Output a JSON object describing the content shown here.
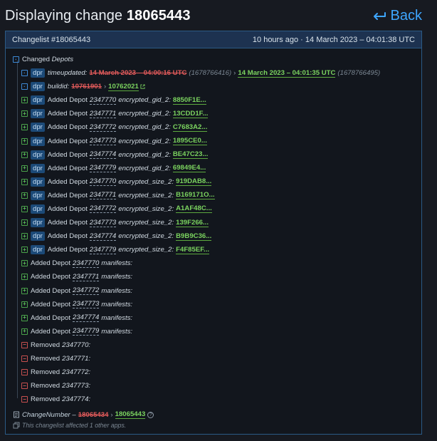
{
  "header": {
    "title_prefix": "Displaying change",
    "change_number": "18065443",
    "back_label": "Back"
  },
  "panel": {
    "title": "Changelist #18065443",
    "time": "10 hours ago · 14 March 2023 – 04:01:38 UTC"
  },
  "tree": {
    "root_label": "Changed",
    "root_label_it": "Depots",
    "timeupdated": {
      "badge": "dpr",
      "key": "timeupdated:",
      "old": "14 March 2023 – 04:00:16 UTC",
      "old_raw": "(1678766416)",
      "new": "14 March 2023 – 04:01:35 UTC",
      "new_raw": "(1678766495)"
    },
    "buildid": {
      "badge": "dpr",
      "key": "buildid:",
      "old": "10761901",
      "new": "10762021"
    },
    "added_keys": [
      {
        "badge": "dpr",
        "depot": "2347770",
        "key": "encrypted_gid_2:",
        "value": "8850F1E..."
      },
      {
        "badge": "dpr",
        "depot": "2347771",
        "key": "encrypted_gid_2:",
        "value": "13CDD1F..."
      },
      {
        "badge": "dpr",
        "depot": "2347772",
        "key": "encrypted_gid_2:",
        "value": "C7683A2..."
      },
      {
        "badge": "dpr",
        "depot": "2347773",
        "key": "encrypted_gid_2:",
        "value": "1895CE0..."
      },
      {
        "badge": "dpr",
        "depot": "2347774",
        "key": "encrypted_gid_2:",
        "value": "BE47C23..."
      },
      {
        "badge": "dpr",
        "depot": "2347779",
        "key": "encrypted_gid_2:",
        "value": "69849E4..."
      },
      {
        "badge": "dpr",
        "depot": "2347770",
        "key": "encrypted_size_2:",
        "value": "919DAB8..."
      },
      {
        "badge": "dpr",
        "depot": "2347771",
        "key": "encrypted_size_2:",
        "value": "B169171O..."
      },
      {
        "badge": "dpr",
        "depot": "2347772",
        "key": "encrypted_size_2:",
        "value": "A1AF48C..."
      },
      {
        "badge": "dpr",
        "depot": "2347773",
        "key": "encrypted_size_2:",
        "value": "139F266..."
      },
      {
        "badge": "dpr",
        "depot": "2347774",
        "key": "encrypted_size_2:",
        "value": "B9B9C36..."
      },
      {
        "badge": "dpr",
        "depot": "2347779",
        "key": "encrypted_size_2:",
        "value": "F4F85EF..."
      }
    ],
    "added_prefix": "Added Depot",
    "added_manifests": [
      {
        "depot": "2347770",
        "key": "manifests:"
      },
      {
        "depot": "2347771",
        "key": "manifests:"
      },
      {
        "depot": "2347772",
        "key": "manifests:"
      },
      {
        "depot": "2347773",
        "key": "manifests:"
      },
      {
        "depot": "2347774",
        "key": "manifests:"
      },
      {
        "depot": "2347779",
        "key": "manifests:"
      }
    ],
    "removed_prefix": "Removed",
    "removed": [
      "2347770:",
      "2347771:",
      "2347772:",
      "2347773:",
      "2347774:"
    ]
  },
  "footer": {
    "change_key": "ChangeNumber –",
    "old": "18065434",
    "new": "18065443",
    "help": "?",
    "affected": "This changelist affected 1 other apps."
  },
  "colors": {
    "accent": "#3ea6ff",
    "added": "#7bd35f",
    "removed": "#e05a5a",
    "badge": "#1c4a78"
  }
}
